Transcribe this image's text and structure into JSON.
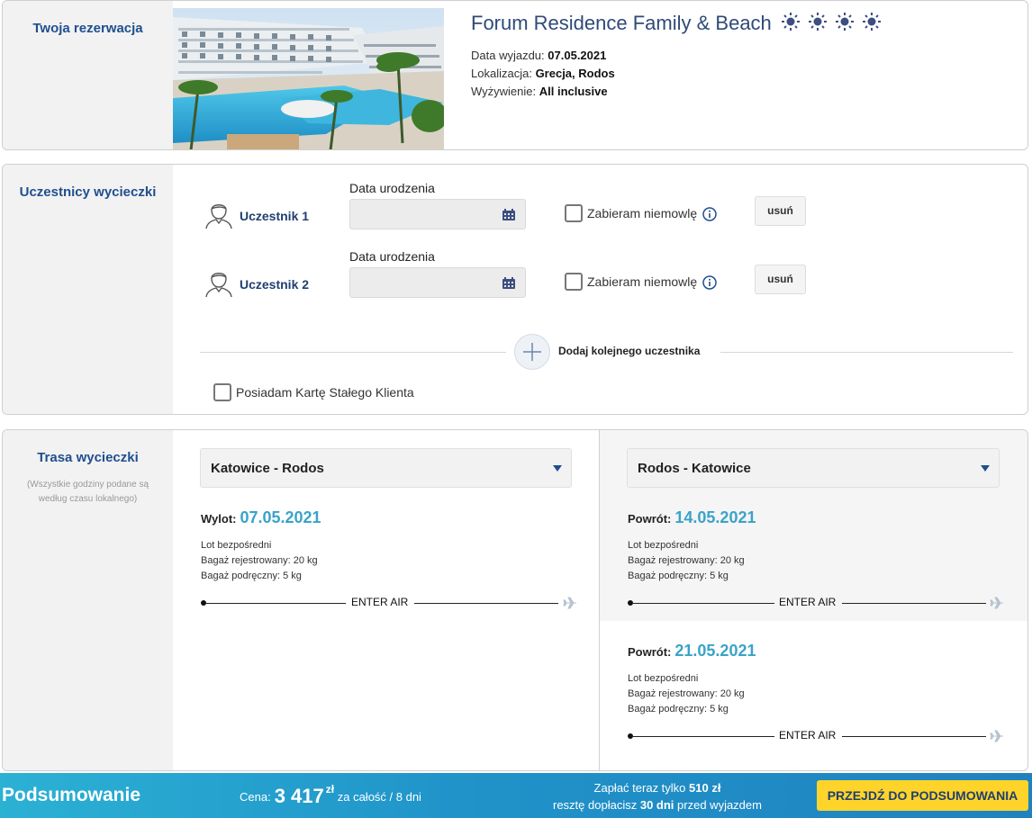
{
  "reservation": {
    "section_title": "Twoja rezerwacja",
    "hotel_name": "Forum Residence Family & Beach",
    "stars": 4,
    "departure_label": "Data wyjazdu:",
    "departure_value": "07.05.2021",
    "location_label": "Lokalizacja:",
    "location_value": "Grecja, Rodos",
    "board_label": "Wyżywienie:",
    "board_value": "All inclusive"
  },
  "participants": {
    "section_title": "Uczestnicy wycieczki",
    "items": [
      {
        "name": "Uczestnik 1",
        "dob_label": "Data urodzenia",
        "dob_value": "",
        "infant_label": "Zabieram niemowlę",
        "infant_checked": false,
        "remove_label": "usuń"
      },
      {
        "name": "Uczestnik 2",
        "dob_label": "Data urodzenia",
        "dob_value": "",
        "infant_label": "Zabieram niemowlę",
        "infant_checked": false,
        "remove_label": "usuń"
      }
    ],
    "add_label": "Dodaj kolejnego uczestnika",
    "loyalty_label": "Posiadam Kartę Stałego Klienta",
    "loyalty_checked": false
  },
  "route": {
    "section_title": "Trasa wycieczki",
    "note": "(Wszystkie godziny podane są według czasu lokalnego)",
    "outbound": {
      "select_label": "Katowice - Rodos",
      "flights": [
        {
          "head_label": "Wylot:",
          "date": "07.05.2021",
          "type": "Lot bezpośredni",
          "checked_baggage": "Bagaż rejestrowany: 20 kg",
          "hand_baggage": "Bagaż podręczny: 5 kg",
          "airline": "ENTER AIR"
        }
      ]
    },
    "return": {
      "select_label": "Rodos - Katowice",
      "flights": [
        {
          "head_label": "Powrót:",
          "date": "14.05.2021",
          "type": "Lot bezpośredni",
          "checked_baggage": "Bagaż rejestrowany: 20 kg",
          "hand_baggage": "Bagaż podręczny: 5 kg",
          "airline": "ENTER AIR",
          "selected": true
        },
        {
          "head_label": "Powrót:",
          "date": "21.05.2021",
          "type": "Lot bezpośredni",
          "checked_baggage": "Bagaż rejestrowany: 20 kg",
          "hand_baggage": "Bagaż podręczny: 5 kg",
          "airline": "ENTER AIR",
          "selected": false
        }
      ]
    }
  },
  "summary": {
    "title": "Podsumowanie",
    "price_label": "Cena:",
    "price_value": "3 417",
    "currency": "zł",
    "price_suffix": "za całość / 8 dni",
    "pay_now_prefix": "Zapłać teraz tylko",
    "pay_now_value": "510 zł",
    "rest_prefix": "resztę dopłacisz",
    "rest_days": "30 dni",
    "rest_suffix": "przed wyjazdem",
    "cta_label": "PRZEJDŹ DO PODSUMOWANIA"
  },
  "colors": {
    "brand_blue": "#1f4f8f",
    "date_accent": "#3aa3c9",
    "cta_yellow": "#ffd42a",
    "bar_start": "#2bb1d4",
    "bar_end": "#1f82bf"
  }
}
